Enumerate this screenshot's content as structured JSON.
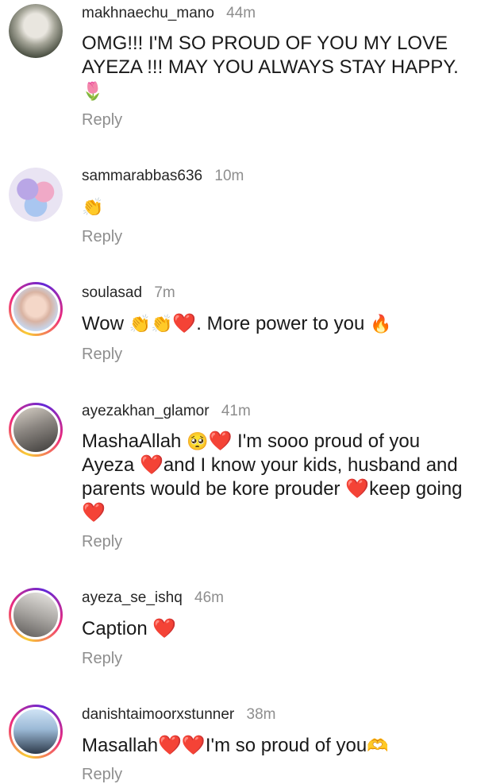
{
  "comments": [
    {
      "username": "makhnaechu_mano",
      "time": "44m",
      "text": "OMG!!! I'M SO PROUD OF YOU MY LOVE AYEZA !!! MAY YOU ALWAYS STAY HAPPY.",
      "emoji": "🌷",
      "reply": "Reply"
    },
    {
      "username": "sammarabbas636",
      "time": "10m",
      "emoji": "👏",
      "reply": "Reply"
    },
    {
      "username": "soulasad",
      "time": "7m",
      "text_a": "Wow ",
      "emoji_a": "👏👏",
      "heart": "❤️",
      "text_b": ". More power to you ",
      "emoji_b": "🔥",
      "reply": "Reply"
    },
    {
      "username": "ayezakhan_glamor",
      "time": "41m",
      "text_a": "MashaAllah ",
      "emoji_a": "🥺",
      "heart_a": "❤️",
      "text_b": " I'm sooo proud of you Ayeza ",
      "heart_b": "❤️",
      "text_c": "and I know your kids, husband and parents would be kore prouder ",
      "heart_c": "❤️",
      "text_d": "keep going ",
      "heart_d": "❤️",
      "reply": "Reply"
    },
    {
      "username": "ayeza_se_ishq",
      "time": "46m",
      "text": "Caption ",
      "heart": "❤️",
      "reply": "Reply"
    },
    {
      "username": "danishtaimoorxstunner",
      "time": "38m",
      "text_a": "Masallah",
      "hearts": "❤️❤️",
      "text_b": "I'm so proud of you",
      "emoji": "🫶",
      "reply": "Reply"
    }
  ],
  "colors": {
    "username": "#262626",
    "secondary": "#8e8e8e",
    "heart": "#e0262f"
  }
}
